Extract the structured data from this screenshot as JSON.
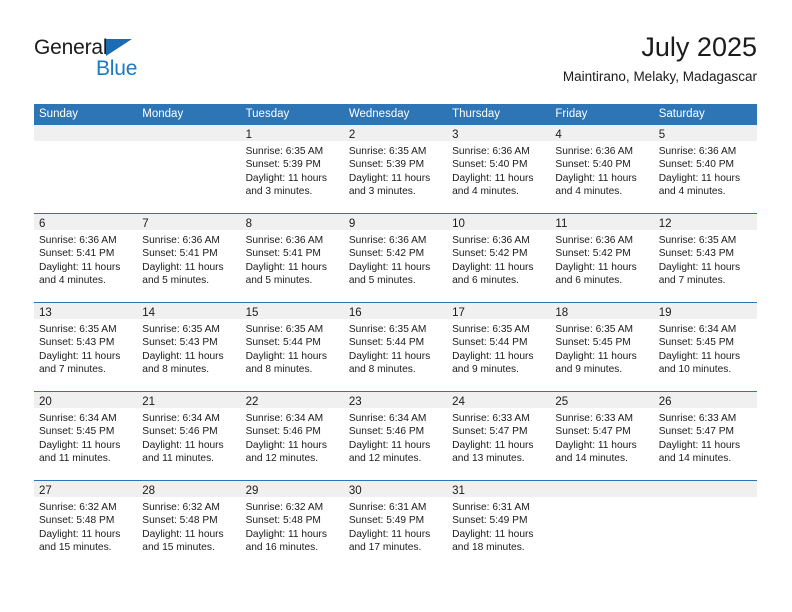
{
  "brand": {
    "name_top": "General",
    "name_bottom": "Blue",
    "triangle_color": "#1b6cb5",
    "blue_color": "#1b7ac4"
  },
  "header": {
    "title": "July 2025",
    "subtitle": "Maintirano, Melaky, Madagascar"
  },
  "theme": {
    "header_blue": "#2e75b6",
    "day_band_gray": "#f0f0f0",
    "rule_blue": "#2e75b6",
    "text": "#1b1b1b"
  },
  "weekdays": [
    "Sunday",
    "Monday",
    "Tuesday",
    "Wednesday",
    "Thursday",
    "Friday",
    "Saturday"
  ],
  "weeks": [
    [
      {
        "day": "",
        "sunrise": "",
        "sunset": "",
        "daylight_line1": "",
        "daylight_line2": ""
      },
      {
        "day": "",
        "sunrise": "",
        "sunset": "",
        "daylight_line1": "",
        "daylight_line2": ""
      },
      {
        "day": "1",
        "sunrise": "Sunrise: 6:35 AM",
        "sunset": "Sunset: 5:39 PM",
        "daylight_line1": "Daylight: 11 hours",
        "daylight_line2": "and 3 minutes."
      },
      {
        "day": "2",
        "sunrise": "Sunrise: 6:35 AM",
        "sunset": "Sunset: 5:39 PM",
        "daylight_line1": "Daylight: 11 hours",
        "daylight_line2": "and 3 minutes."
      },
      {
        "day": "3",
        "sunrise": "Sunrise: 6:36 AM",
        "sunset": "Sunset: 5:40 PM",
        "daylight_line1": "Daylight: 11 hours",
        "daylight_line2": "and 4 minutes."
      },
      {
        "day": "4",
        "sunrise": "Sunrise: 6:36 AM",
        "sunset": "Sunset: 5:40 PM",
        "daylight_line1": "Daylight: 11 hours",
        "daylight_line2": "and 4 minutes."
      },
      {
        "day": "5",
        "sunrise": "Sunrise: 6:36 AM",
        "sunset": "Sunset: 5:40 PM",
        "daylight_line1": "Daylight: 11 hours",
        "daylight_line2": "and 4 minutes."
      }
    ],
    [
      {
        "day": "6",
        "sunrise": "Sunrise: 6:36 AM",
        "sunset": "Sunset: 5:41 PM",
        "daylight_line1": "Daylight: 11 hours",
        "daylight_line2": "and 4 minutes."
      },
      {
        "day": "7",
        "sunrise": "Sunrise: 6:36 AM",
        "sunset": "Sunset: 5:41 PM",
        "daylight_line1": "Daylight: 11 hours",
        "daylight_line2": "and 5 minutes."
      },
      {
        "day": "8",
        "sunrise": "Sunrise: 6:36 AM",
        "sunset": "Sunset: 5:41 PM",
        "daylight_line1": "Daylight: 11 hours",
        "daylight_line2": "and 5 minutes."
      },
      {
        "day": "9",
        "sunrise": "Sunrise: 6:36 AM",
        "sunset": "Sunset: 5:42 PM",
        "daylight_line1": "Daylight: 11 hours",
        "daylight_line2": "and 5 minutes."
      },
      {
        "day": "10",
        "sunrise": "Sunrise: 6:36 AM",
        "sunset": "Sunset: 5:42 PM",
        "daylight_line1": "Daylight: 11 hours",
        "daylight_line2": "and 6 minutes."
      },
      {
        "day": "11",
        "sunrise": "Sunrise: 6:36 AM",
        "sunset": "Sunset: 5:42 PM",
        "daylight_line1": "Daylight: 11 hours",
        "daylight_line2": "and 6 minutes."
      },
      {
        "day": "12",
        "sunrise": "Sunrise: 6:35 AM",
        "sunset": "Sunset: 5:43 PM",
        "daylight_line1": "Daylight: 11 hours",
        "daylight_line2": "and 7 minutes."
      }
    ],
    [
      {
        "day": "13",
        "sunrise": "Sunrise: 6:35 AM",
        "sunset": "Sunset: 5:43 PM",
        "daylight_line1": "Daylight: 11 hours",
        "daylight_line2": "and 7 minutes."
      },
      {
        "day": "14",
        "sunrise": "Sunrise: 6:35 AM",
        "sunset": "Sunset: 5:43 PM",
        "daylight_line1": "Daylight: 11 hours",
        "daylight_line2": "and 8 minutes."
      },
      {
        "day": "15",
        "sunrise": "Sunrise: 6:35 AM",
        "sunset": "Sunset: 5:44 PM",
        "daylight_line1": "Daylight: 11 hours",
        "daylight_line2": "and 8 minutes."
      },
      {
        "day": "16",
        "sunrise": "Sunrise: 6:35 AM",
        "sunset": "Sunset: 5:44 PM",
        "daylight_line1": "Daylight: 11 hours",
        "daylight_line2": "and 8 minutes."
      },
      {
        "day": "17",
        "sunrise": "Sunrise: 6:35 AM",
        "sunset": "Sunset: 5:44 PM",
        "daylight_line1": "Daylight: 11 hours",
        "daylight_line2": "and 9 minutes."
      },
      {
        "day": "18",
        "sunrise": "Sunrise: 6:35 AM",
        "sunset": "Sunset: 5:45 PM",
        "daylight_line1": "Daylight: 11 hours",
        "daylight_line2": "and 9 minutes."
      },
      {
        "day": "19",
        "sunrise": "Sunrise: 6:34 AM",
        "sunset": "Sunset: 5:45 PM",
        "daylight_line1": "Daylight: 11 hours",
        "daylight_line2": "and 10 minutes."
      }
    ],
    [
      {
        "day": "20",
        "sunrise": "Sunrise: 6:34 AM",
        "sunset": "Sunset: 5:45 PM",
        "daylight_line1": "Daylight: 11 hours",
        "daylight_line2": "and 11 minutes."
      },
      {
        "day": "21",
        "sunrise": "Sunrise: 6:34 AM",
        "sunset": "Sunset: 5:46 PM",
        "daylight_line1": "Daylight: 11 hours",
        "daylight_line2": "and 11 minutes."
      },
      {
        "day": "22",
        "sunrise": "Sunrise: 6:34 AM",
        "sunset": "Sunset: 5:46 PM",
        "daylight_line1": "Daylight: 11 hours",
        "daylight_line2": "and 12 minutes."
      },
      {
        "day": "23",
        "sunrise": "Sunrise: 6:34 AM",
        "sunset": "Sunset: 5:46 PM",
        "daylight_line1": "Daylight: 11 hours",
        "daylight_line2": "and 12 minutes."
      },
      {
        "day": "24",
        "sunrise": "Sunrise: 6:33 AM",
        "sunset": "Sunset: 5:47 PM",
        "daylight_line1": "Daylight: 11 hours",
        "daylight_line2": "and 13 minutes."
      },
      {
        "day": "25",
        "sunrise": "Sunrise: 6:33 AM",
        "sunset": "Sunset: 5:47 PM",
        "daylight_line1": "Daylight: 11 hours",
        "daylight_line2": "and 14 minutes."
      },
      {
        "day": "26",
        "sunrise": "Sunrise: 6:33 AM",
        "sunset": "Sunset: 5:47 PM",
        "daylight_line1": "Daylight: 11 hours",
        "daylight_line2": "and 14 minutes."
      }
    ],
    [
      {
        "day": "27",
        "sunrise": "Sunrise: 6:32 AM",
        "sunset": "Sunset: 5:48 PM",
        "daylight_line1": "Daylight: 11 hours",
        "daylight_line2": "and 15 minutes."
      },
      {
        "day": "28",
        "sunrise": "Sunrise: 6:32 AM",
        "sunset": "Sunset: 5:48 PM",
        "daylight_line1": "Daylight: 11 hours",
        "daylight_line2": "and 15 minutes."
      },
      {
        "day": "29",
        "sunrise": "Sunrise: 6:32 AM",
        "sunset": "Sunset: 5:48 PM",
        "daylight_line1": "Daylight: 11 hours",
        "daylight_line2": "and 16 minutes."
      },
      {
        "day": "30",
        "sunrise": "Sunrise: 6:31 AM",
        "sunset": "Sunset: 5:49 PM",
        "daylight_line1": "Daylight: 11 hours",
        "daylight_line2": "and 17 minutes."
      },
      {
        "day": "31",
        "sunrise": "Sunrise: 6:31 AM",
        "sunset": "Sunset: 5:49 PM",
        "daylight_line1": "Daylight: 11 hours",
        "daylight_line2": "and 18 minutes."
      },
      {
        "day": "",
        "sunrise": "",
        "sunset": "",
        "daylight_line1": "",
        "daylight_line2": ""
      },
      {
        "day": "",
        "sunrise": "",
        "sunset": "",
        "daylight_line1": "",
        "daylight_line2": ""
      }
    ]
  ]
}
